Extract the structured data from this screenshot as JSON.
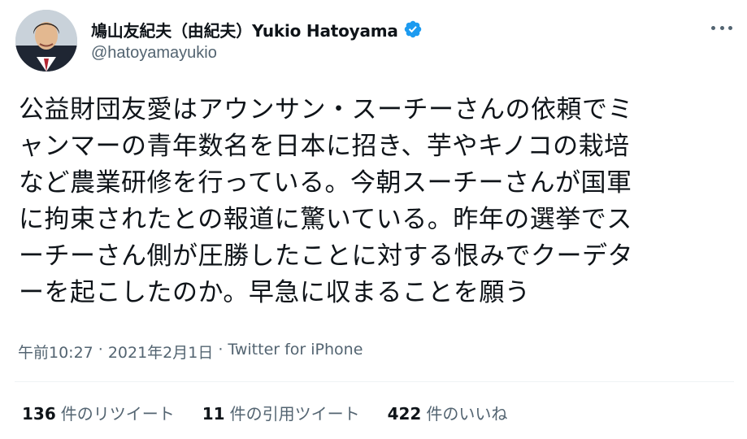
{
  "author": {
    "display_name": "鳩山友紀夫（由紀夫）Yukio Hatoyama",
    "handle": "@hatoyamayukio",
    "verified": true,
    "avatar_icon": "profile-photo",
    "verified_color": "#1d9bf0"
  },
  "menu": {
    "icon": "more-horizontal-icon"
  },
  "tweet": {
    "lines": [
      "公益財団友愛はアウンサン・スーチーさんの依頼でミ",
      "ャンマーの青年数名を日本に招き、芋やキノコの栽培",
      "など農業研修を行っている。今朝スーチーさんが国軍",
      "に拘束されたとの報道に驚いている。昨年の選挙でス",
      "ーチーさん側が圧勝したことに対する恨みでクーデタ",
      "ーを起こしたのか。早急に収まることを願う"
    ],
    "time": "午前10:27",
    "separator1": "·",
    "date": "2021年2月1日",
    "separator2": "·",
    "source": "Twitter for iPhone"
  },
  "stats": {
    "retweets": {
      "count": "136",
      "label": "件のリツイート"
    },
    "quotes": {
      "count": "11",
      "label": "件の引用ツイート"
    },
    "likes": {
      "count": "422",
      "label": "件のいいね"
    }
  }
}
